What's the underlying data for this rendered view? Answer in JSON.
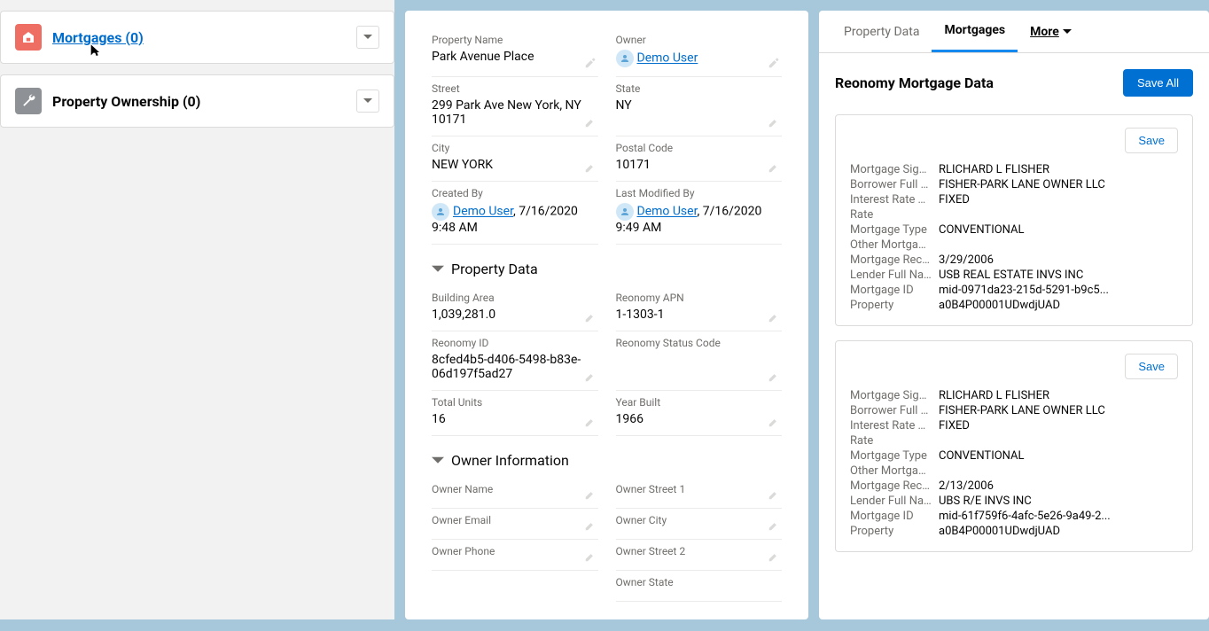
{
  "left": {
    "mortgages": {
      "label": "Mortgages (0)"
    },
    "ownership": {
      "label": "Property Ownership (0)"
    }
  },
  "mid": {
    "propertyName": {
      "label": "Property Name",
      "value": "Park Avenue Place"
    },
    "owner": {
      "label": "Owner",
      "value": "Demo User"
    },
    "street": {
      "label": "Street",
      "value": "299 Park Ave New York, NY 10171"
    },
    "state": {
      "label": "State",
      "value": "NY"
    },
    "city": {
      "label": "City",
      "value": "NEW YORK"
    },
    "postal": {
      "label": "Postal Code",
      "value": "10171"
    },
    "createdBy": {
      "label": "Created By",
      "user": "Demo User",
      "ts": ", 7/16/2020 9:48 AM"
    },
    "modifiedBy": {
      "label": "Last Modified By",
      "user": "Demo User",
      "ts": ", 7/16/2020 9:49 AM"
    },
    "section1": "Property Data",
    "buildingArea": {
      "label": "Building Area",
      "value": "1,039,281.0"
    },
    "apn": {
      "label": "Reonomy APN",
      "value": "1-1303-1"
    },
    "reonomyId": {
      "label": "Reonomy ID",
      "value": "8cfed4b5-d406-5498-b83e-06d197f5ad27"
    },
    "statusCode": {
      "label": "Reonomy Status Code",
      "value": ""
    },
    "totalUnits": {
      "label": "Total Units",
      "value": "16"
    },
    "yearBuilt": {
      "label": "Year Built",
      "value": "1966"
    },
    "section2": "Owner Information",
    "ownerName": {
      "label": "Owner Name",
      "value": ""
    },
    "ownerStreet1": {
      "label": "Owner Street 1",
      "value": ""
    },
    "ownerEmail": {
      "label": "Owner Email",
      "value": ""
    },
    "ownerCity": {
      "label": "Owner City",
      "value": ""
    },
    "ownerPhone": {
      "label": "Owner Phone",
      "value": ""
    },
    "ownerStreet2": {
      "label": "Owner Street 2",
      "value": ""
    },
    "ownerState": {
      "label": "Owner State",
      "value": ""
    }
  },
  "right": {
    "tabs": {
      "propertyData": "Property Data",
      "mortgages": "Mortgages",
      "more": "More"
    },
    "title": "Reonomy Mortgage Data",
    "saveAll": "Save All",
    "saveLabel": "Save",
    "keys": {
      "signa": "Mortgage Signa...",
      "borrower": "Borrower Full N...",
      "irType": "Interest Rate Ty...",
      "rate": "Rate",
      "mtype": "Mortgage Type",
      "other": "Other Mortgage...",
      "recor": "Mortgage Recor...",
      "lender": "Lender Full Name",
      "mid": "Mortgage ID",
      "property": "Property"
    },
    "mortgages": [
      {
        "signa": "RLICHARD L FLISHER",
        "borrower": "FISHER-PARK LANE OWNER LLC",
        "irType": "FIXED",
        "rate": "",
        "mtype": "CONVENTIONAL",
        "other": "",
        "recor": "3/29/2006",
        "lender": "USB REAL ESTATE INVS INC",
        "mid": "mid-0971da23-215d-5291-b9c5...",
        "property": "a0B4P00001UDwdjUAD"
      },
      {
        "signa": "RLICHARD L FLISHER",
        "borrower": "FISHER-PARK LANE OWNER LLC",
        "irType": "FIXED",
        "rate": "",
        "mtype": "CONVENTIONAL",
        "other": "",
        "recor": "2/13/2006",
        "lender": "UBS R/E INVS INC",
        "mid": "mid-61f759f6-4afc-5e26-9a49-2...",
        "property": "a0B4P00001UDwdjUAD"
      }
    ]
  }
}
